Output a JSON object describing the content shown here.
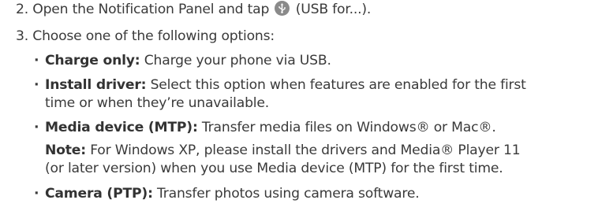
{
  "steps": [
    {
      "number": "2.",
      "text_before": "Open the Notification Panel and tap",
      "icon": "usb-icon",
      "text_after": "(USB for...)."
    },
    {
      "number": "3.",
      "text": "Choose one of the following options:"
    }
  ],
  "options": [
    {
      "label": "Charge only:",
      "description": "Charge your phone via USB."
    },
    {
      "label": "Install driver:",
      "description": "Select this option when features are enabled for the first",
      "description_cont": "time or when they’re unavailable."
    },
    {
      "label": "Media device (MTP):",
      "description": "Transfer media files on Windows® or Mac®."
    },
    {
      "label": "Camera (PTP):",
      "description": "Transfer photos using camera software."
    }
  ],
  "note": {
    "label": "Note:",
    "text": "For Windows XP, please install the drivers and Media® Player 11",
    "text_cont": "(or later version) when you use Media device (MTP) for the first time."
  },
  "bullet_char": "·"
}
